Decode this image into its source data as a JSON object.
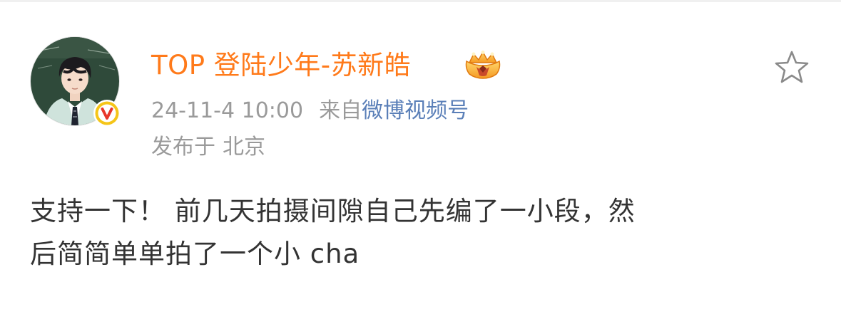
{
  "post": {
    "author": {
      "name": "TOP 登陆少年-苏新皓",
      "avatar_icon": "user-avatar",
      "verified_icon": "verified-v-icon",
      "vip_icon": "vip-crown-icon"
    },
    "meta": {
      "time": "24-11-4 10:00",
      "source_prefix": "来自",
      "source": "微博视频号",
      "location_prefix": "发布于",
      "location": "北京"
    },
    "body": {
      "line1": "支持一下！ 前几天拍摄间隙自己先编了一小段，然",
      "line2": "后简简单单拍了一个小 cha"
    },
    "favorite_icon": "star-outline-icon"
  },
  "colors": {
    "username": "#ff7a1a",
    "meta_text": "#9a9a9a",
    "source_link": "#5a7fb8",
    "body_text": "#333333",
    "verified_badge": "#f5c518",
    "verified_v": "#e8372b"
  }
}
